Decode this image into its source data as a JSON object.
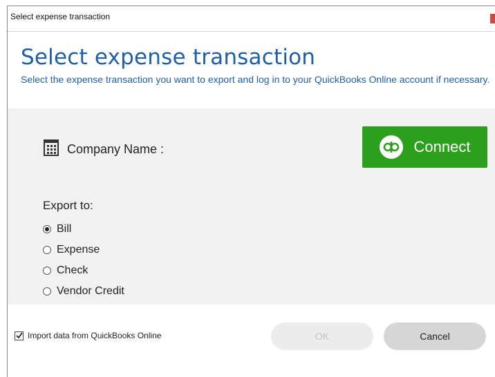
{
  "window": {
    "title": "Select expense transaction"
  },
  "header": {
    "title": "Select expense transaction",
    "description": "Select the expense transaction you want to export and log in to your QuickBooks Online account if necessary."
  },
  "company": {
    "label": "Company Name :",
    "icon": "building-icon"
  },
  "connect": {
    "label": "Connect",
    "icon": "quickbooks-logo-icon",
    "color": "#2ca01c"
  },
  "export": {
    "label": "Export to:",
    "options": [
      "Bill",
      "Expense",
      "Check",
      "Vendor Credit"
    ],
    "selected": "Bill"
  },
  "import_option": {
    "label": "Import data from QuickBooks Online",
    "checked": true
  },
  "buttons": {
    "ok": "OK",
    "cancel": "Cancel"
  },
  "colors": {
    "heading": "#1f5fa9",
    "close_accent": "#c94d45"
  }
}
